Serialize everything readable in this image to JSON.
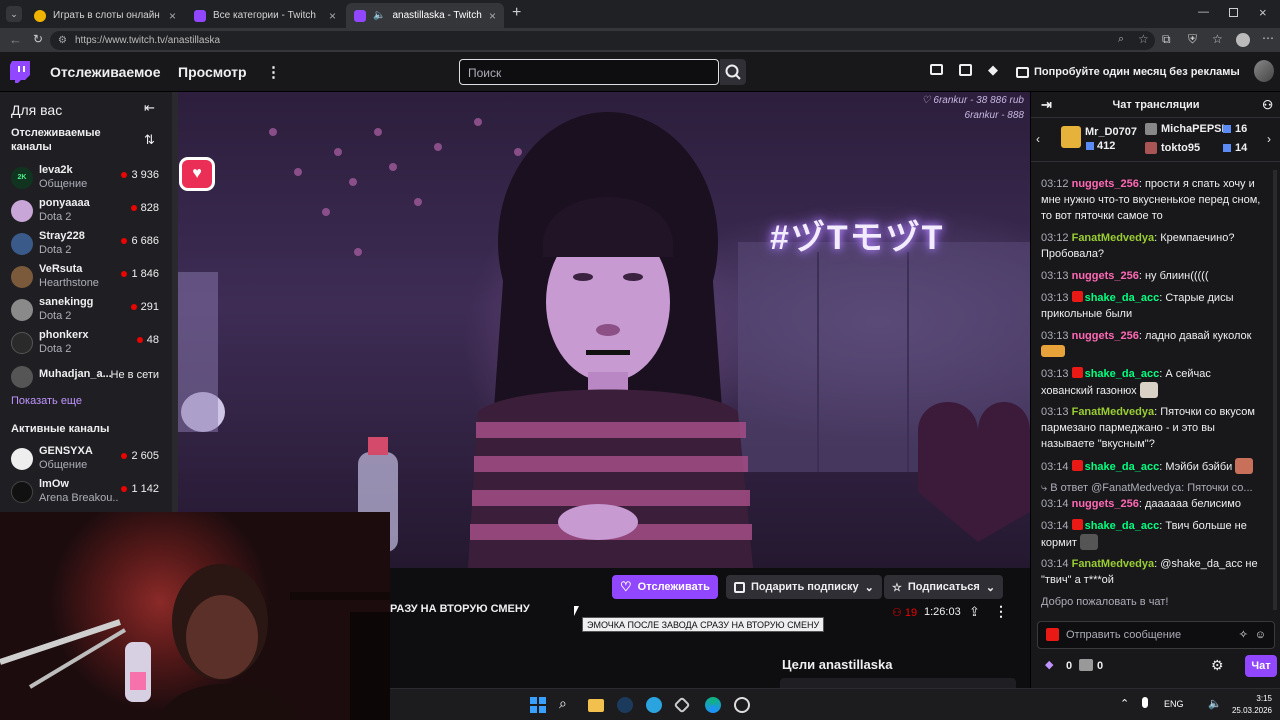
{
  "browser": {
    "tabs": [
      {
        "label": "Играть в слоты онлайн в казино"
      },
      {
        "label": "Все категории - Twitch"
      },
      {
        "label": "anastillaska - Twitch"
      }
    ],
    "url": "https://www.twitch.tv/anastillaska"
  },
  "nav": {
    "following": "Отслеживаемое",
    "browse": "Просмотр",
    "search_placeholder": "Поиск",
    "promo": "Попробуйте один месяц без рекламы"
  },
  "sidebar": {
    "for_you": "Для вас",
    "followed_header": "Отслеживаемые каналы",
    "followed": [
      {
        "name": "leva2k",
        "game": "Общение",
        "viewers": "3 936"
      },
      {
        "name": "ponyaaaa",
        "game": "Dota 2",
        "viewers": "828"
      },
      {
        "name": "Stray228",
        "game": "Dota 2",
        "viewers": "6 686"
      },
      {
        "name": "VeRsuta",
        "game": "Hearthstone",
        "viewers": "1 846"
      },
      {
        "name": "sanekingg",
        "game": "Dota 2",
        "viewers": "291"
      },
      {
        "name": "phonkerx",
        "game": "Dota 2",
        "viewers": "48"
      },
      {
        "name": "Muhadjan_a...",
        "game": "",
        "viewers": "Не в сети"
      }
    ],
    "show_more": "Показать еще",
    "active_header": "Активные каналы",
    "active": [
      {
        "name": "GENSYXA",
        "game": "Общение",
        "viewers": "2 605"
      },
      {
        "name": "lmOw",
        "game": "Arena Breakou...",
        "viewers": "1 142"
      }
    ]
  },
  "video": {
    "overlay_top": "♡ 6rankur - 38 886 rub",
    "overlay_sub": "6rankur - 888",
    "neon_sign": "#ヅTモヅT"
  },
  "stream": {
    "title": "РАЗУ НА ВТОРУЮ СМЕНУ",
    "tooltip": "ЭМОЧКА ПОСЛЕ ЗАВОДА СРАЗУ НА ВТОРУЮ СМЕНУ",
    "follow": "Отслеживать",
    "gift": "Подарить подписку",
    "subscribe": "Подписаться",
    "viewers": "19",
    "uptime": "1:26:03",
    "goals": "Цели anastillaska"
  },
  "chat": {
    "header": "Чат трансляции",
    "gifters": [
      {
        "name": "Mr_D0707",
        "count": "412"
      },
      {
        "name": "MichaPEPSI",
        "count": "16"
      },
      {
        "name": "tokto95",
        "count": "14"
      }
    ],
    "messages": [
      {
        "time": "03:12",
        "user": "nuggets_256",
        "color": "#ff69b4",
        "text": "прости я спать хочу и мне нужно что-то вкусненькое перед сном, то вот пяточки самое то"
      },
      {
        "time": "03:12",
        "user": "FanatMedvedya",
        "color": "#9acd32",
        "text": "Кремпаечино? Пробовала?"
      },
      {
        "time": "03:13",
        "user": "nuggets_256",
        "color": "#ff69b4",
        "text": "ну блиин((((("
      },
      {
        "time": "03:13",
        "user": "shake_da_acc",
        "color": "#00ff7f",
        "text": "Старые дисы прикольные были"
      },
      {
        "time": "03:13",
        "user": "nuggets_256",
        "color": "#ff69b4",
        "text": "ладно давай куколок"
      },
      {
        "time": "03:13",
        "user": "shake_da_acc",
        "color": "#00ff7f",
        "text": "А сейчас хованский газонюх"
      },
      {
        "time": "03:13",
        "user": "FanatMedvedya",
        "color": "#9acd32",
        "text": "Пяточки со вкусом пармезано пармеджано - и это вы называете \"вкусным\"?"
      },
      {
        "time": "03:14",
        "user": "shake_da_acc",
        "color": "#00ff7f",
        "text": "Мэйби бэйби"
      },
      {
        "time": "03:14",
        "user": "nuggets_256",
        "color": "#ff69b4",
        "text": "даааааа белисимо"
      },
      {
        "time": "03:14",
        "user": "shake_da_acc",
        "color": "#00ff7f",
        "text": "Твич больше не кормит"
      },
      {
        "time": "03:14",
        "user": "FanatMedvedya",
        "color": "#9acd32",
        "text": "@shake_da_acc не \"твич\" а т***ой"
      }
    ],
    "reply_ref": "В ответ @FanatMedvedya: Пяточки со...",
    "welcome": "Добро пожаловать в чат!",
    "input_placeholder": "Отправить сообщение",
    "points_a": "0",
    "points_b": "0",
    "send": "Чат"
  },
  "taskbar": {
    "lang": "ENG",
    "time": "3:15",
    "date": "25.03.2026"
  },
  "colors": {
    "accent": "#9147ff",
    "live": "#eb0400",
    "bg": "#0e0e10"
  }
}
